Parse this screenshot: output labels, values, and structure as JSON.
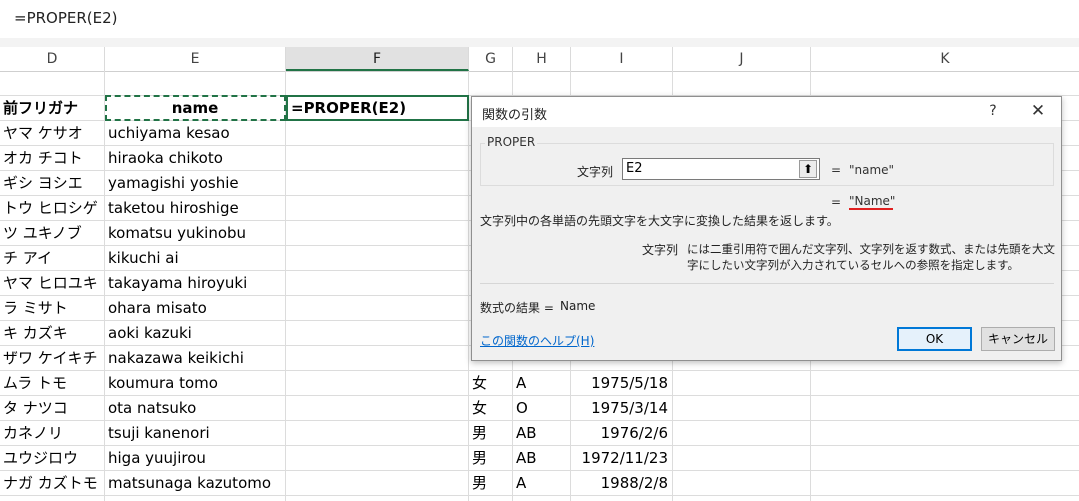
{
  "formula_bar": {
    "text": "=PROPER(E2)"
  },
  "columns": [
    {
      "id": "D",
      "label": "D"
    },
    {
      "id": "E",
      "label": "E"
    },
    {
      "id": "F",
      "label": "F"
    },
    {
      "id": "G",
      "label": "G"
    },
    {
      "id": "H",
      "label": "H"
    },
    {
      "id": "I",
      "label": "I"
    },
    {
      "id": "J",
      "label": "J"
    },
    {
      "id": "K",
      "label": "K"
    }
  ],
  "header_row": {
    "d": "前フリガナ",
    "e": "name",
    "f": "=PROPER(E2)"
  },
  "rows": [
    {
      "d": "ヤマ ケサオ",
      "e": "uchiyama kesao",
      "g": "",
      "h": "",
      "i": ""
    },
    {
      "d": "オカ チコト",
      "e": "hiraoka chikoto",
      "g": "",
      "h": "",
      "i": ""
    },
    {
      "d": "ギシ ヨシエ",
      "e": "yamagishi yoshie",
      "g": "",
      "h": "",
      "i": ""
    },
    {
      "d": "トウ ヒロシゲ",
      "e": "taketou hiroshige",
      "g": "",
      "h": "",
      "i": ""
    },
    {
      "d": "ツ ユキノブ",
      "e": "komatsu yukinobu",
      "g": "",
      "h": "",
      "i": ""
    },
    {
      "d": "チ アイ",
      "e": "kikuchi ai",
      "g": "",
      "h": "",
      "i": ""
    },
    {
      "d": "ヤマ ヒロユキ",
      "e": "takayama hiroyuki",
      "g": "",
      "h": "",
      "i": ""
    },
    {
      "d": "ラ ミサト",
      "e": "ohara misato",
      "g": "",
      "h": "",
      "i": ""
    },
    {
      "d": "キ カズキ",
      "e": "aoki kazuki",
      "g": "",
      "h": "",
      "i": ""
    },
    {
      "d": "ザワ ケイキチ",
      "e": "nakazawa keikichi",
      "g": "",
      "h": "",
      "i": ""
    },
    {
      "d": "ムラ トモ",
      "e": "koumura tomo",
      "g": "女",
      "h": "A",
      "i": "1975/5/18"
    },
    {
      "d": "タ ナツコ",
      "e": "ota natsuko",
      "g": "女",
      "h": "O",
      "i": "1975/3/14"
    },
    {
      "d": "カネノリ",
      "e": "tsuji kanenori",
      "g": "男",
      "h": "AB",
      "i": "1976/2/6"
    },
    {
      "d": "ユウジロウ",
      "e": "higa yuujirou",
      "g": "男",
      "h": "AB",
      "i": "1972/11/23"
    },
    {
      "d": "ナガ カズトモ",
      "e": "matsunaga kazutomo",
      "g": "男",
      "h": "A",
      "i": "1988/2/8"
    }
  ],
  "dialog": {
    "title": "関数の引数",
    "help_button": "?",
    "close_button": "✕",
    "function_name": "PROPER",
    "arg_label": "文字列",
    "arg_value": "E2",
    "collapse_icon": "⬆",
    "arg_result_eq": "=",
    "arg_result": "\"name\"",
    "formula_result_eq": "=",
    "formula_result": "\"Name\"",
    "description": "文字列中の各単語の先頭文字を大文字に変換した結果を返します。",
    "arg_desc_label": "文字列",
    "arg_desc": "には二重引用符で囲んだ文字列、文字列を返す数式、または先頭を大文字にしたい文字列が入力されているセルへの参照を指定します。",
    "result_label": "数式の結果 =",
    "result_value": "Name",
    "help_link": "この関数のヘルプ(H)",
    "ok_label": "OK",
    "cancel_label": "キャンセル"
  }
}
